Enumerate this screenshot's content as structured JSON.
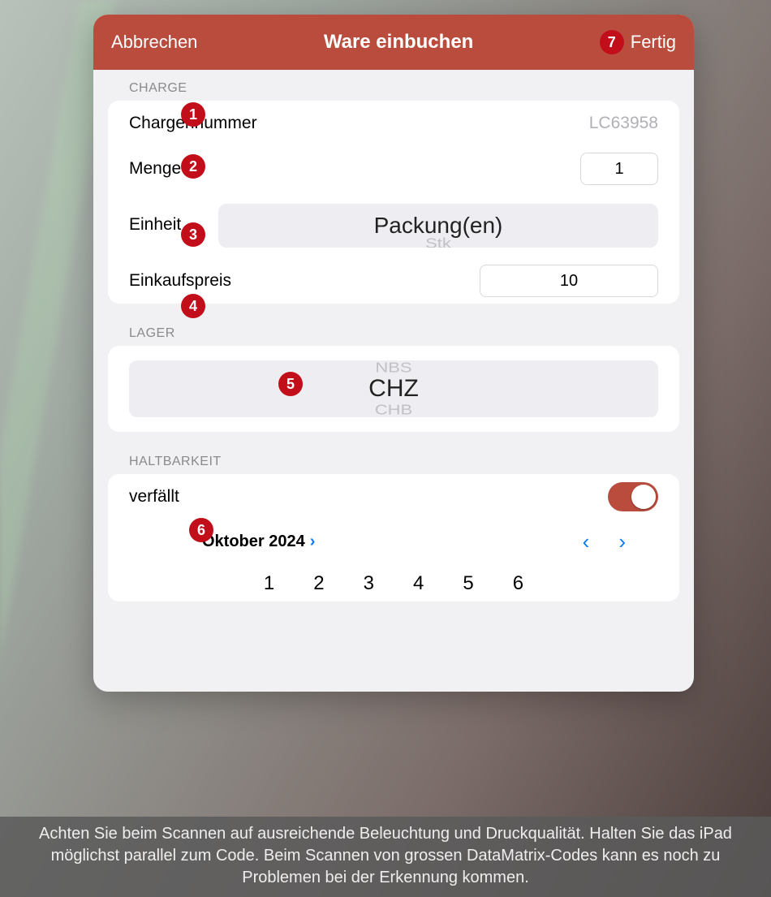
{
  "header": {
    "cancel": "Abbrechen",
    "title": "Ware einbuchen",
    "done": "Fertig"
  },
  "annotations": {
    "a1": "1",
    "a2": "2",
    "a3": "3",
    "a4": "4",
    "a5": "5",
    "a6": "6",
    "a7": "7"
  },
  "charge": {
    "section": "CHARGE",
    "batch_label": "Chargennummer",
    "batch_value": "LC63958",
    "qty_label": "Menge",
    "qty_value": "1",
    "unit_label": "Einheit",
    "unit_selected": "Packung(en)",
    "unit_below": "Stk",
    "price_label": "Einkaufspreis",
    "price_value": "10"
  },
  "lager": {
    "section": "LAGER",
    "above": "NBS",
    "selected": "CHZ",
    "below": "CHB"
  },
  "expiry": {
    "section": "HALTBARKEIT",
    "expires_label": "verfällt",
    "toggle_on": true,
    "month_label": "Oktober 2024",
    "days": [
      "1",
      "2",
      "3",
      "4",
      "5",
      "6"
    ]
  },
  "footer_tip": "Achten Sie beim Scannen auf ausreichende Beleuchtung und Druckqualität. Halten Sie das iPad möglichst parallel zum Code. Beim Scannen von grossen DataMatrix-Codes kann es noch zu Problemen bei der Erkennung kommen."
}
